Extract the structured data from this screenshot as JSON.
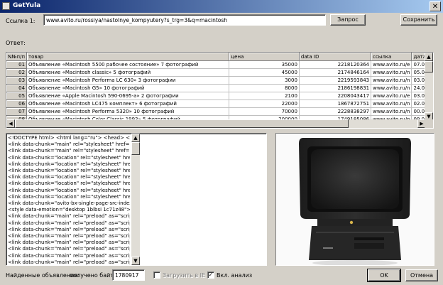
{
  "window": {
    "title": "GetYula",
    "close_glyph": "✕"
  },
  "url_label": "Ссылка 1:",
  "url_value": "www.avito.ru/rossiya/nastolnye_kompyutery?s_trg=3&q=macintosh",
  "buttons": {
    "request": "Запрос",
    "save": "Сохранить",
    "ok": "OK",
    "cancel": "Отмена"
  },
  "answer_label": "Ответ:",
  "table": {
    "headers": [
      "N№п/п",
      "товар",
      "цена",
      "data ID",
      "ссылка",
      "дата"
    ],
    "rows": [
      [
        "01",
        "Объявление «Macintosh 5500 рабочее состояние» 7 фотографий",
        "35000",
        "2218120364",
        "www.avito.ru/e",
        "07.09"
      ],
      [
        "02",
        "Объявление «Macintosh classic» 5 фотографий",
        "45000",
        "2174846164",
        "www.avito.ru/n",
        "05.09"
      ],
      [
        "03",
        "Объявление «Macintosh Performa LC 630» 3 фотографии",
        "3000",
        "2219593843",
        "www.avito.ru/n",
        "03.09"
      ],
      [
        "04",
        "Объявление «Macintosh G5» 10 фотографий",
        "8000",
        "2186198831",
        "www.avito.ru/n",
        "24.08"
      ],
      [
        "05",
        "Объявление «Apple Macintosh 590-0695-a» 2 фотографии",
        "2100",
        "2208043417",
        "www.avito.ru/e",
        "03.09"
      ],
      [
        "06",
        "Объявление «Macintosh LC475 комплект» 6 фотографий",
        "22000",
        "1867872751",
        "www.avito.ru/n",
        "02.09"
      ],
      [
        "07",
        "Объявление «Macintosh Performa 5320» 10 фотографий",
        "70000",
        "2228838297",
        "www.avito.ru/n",
        "00.09"
      ],
      [
        "08",
        "Объявление «Macintosh Color Classic 1993» 5 фотографий",
        "200000",
        "1749185086",
        "www.avito.ru/n",
        "09.09"
      ]
    ]
  },
  "source_lines": [
    "<!DOCTYPE html> <html lang=\"ru\"> <head> <link re",
    "<link data-chunk=\"main\" rel=\"stylesheet\" href=\"/ds",
    "<link data-chunk=\"main\" rel=\"stylesheet\" href=\"/ds",
    "<link data-chunk=\"location\" rel=\"stylesheet\" href=\"",
    "<link data-chunk=\"location\" rel=\"stylesheet\" href=\"",
    "<link data-chunk=\"location\" rel=\"stylesheet\" href=\"",
    "<link data-chunk=\"location\" rel=\"stylesheet\" href=\"",
    "<link data-chunk=\"location\" rel=\"stylesheet\" href=\"",
    "<link data-chunk=\"location\" rel=\"stylesheet\" href=\"",
    "<link data-chunk=\"location\" rel=\"stylesheet\" href=\"",
    "<link data-chunk=\"avito-bx-single-page-src-index-c",
    "<style data-emotion=\"desktop 1blbsi 1c71z48\">.de",
    "<link data-chunk=\"main\" rel=\"preload\" as=\"script\" h",
    "<link data-chunk=\"main\" rel=\"preload\" as=\"script\" h",
    "<link data-chunk=\"main\" rel=\"preload\" as=\"script\" h",
    "<link data-chunk=\"main\" rel=\"preload\" as=\"script\" h",
    "<link data-chunk=\"main\" rel=\"preload\" as=\"script\" h",
    "<link data-chunk=\"main\" rel=\"preload\" as=\"script\" h",
    "<link data-chunk=\"main\" rel=\"preload\" as=\"script\" h",
    "<link data-chunk=\"main\" rel=\"preload\" as=\"script\" h"
  ],
  "footer": {
    "found_label": "Найденные объявления:",
    "bytes_label": "получено байт:",
    "bytes_value": "1780917",
    "load_ie_label": "Загрузить в IE",
    "analysis_label": "Вкл. анализ",
    "analysis_checked": "✓"
  },
  "icons": {
    "scroll_up": "▲",
    "scroll_down": "▼",
    "scroll_left": "◀",
    "scroll_right": "▶"
  }
}
